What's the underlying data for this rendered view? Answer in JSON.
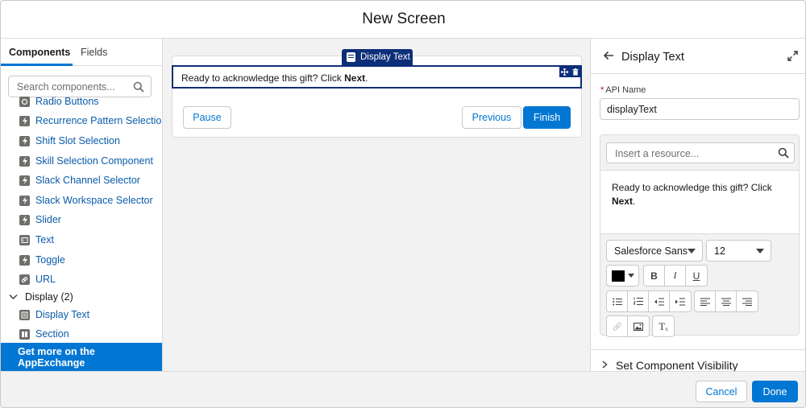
{
  "header": {
    "title": "New Screen"
  },
  "left_panel": {
    "tabs": [
      {
        "label": "Components",
        "active": true
      },
      {
        "label": "Fields",
        "active": false
      }
    ],
    "search": {
      "placeholder": "Search components..."
    },
    "items": [
      {
        "label": "Radio Buttons",
        "icon": "component-icon"
      },
      {
        "label": "Recurrence Pattern Selection",
        "icon": "lightning-icon"
      },
      {
        "label": "Shift Slot Selection",
        "icon": "lightning-icon"
      },
      {
        "label": "Skill Selection Component",
        "icon": "lightning-icon"
      },
      {
        "label": "Slack Channel Selector",
        "icon": "lightning-icon"
      },
      {
        "label": "Slack Workspace Selector",
        "icon": "lightning-icon"
      },
      {
        "label": "Slider",
        "icon": "lightning-icon"
      },
      {
        "label": "Text",
        "icon": "text-field-icon"
      },
      {
        "label": "Toggle",
        "icon": "lightning-icon"
      },
      {
        "label": "URL",
        "icon": "link-icon"
      }
    ],
    "display_section": {
      "label": "Display (2)",
      "items": [
        {
          "label": "Display Text",
          "icon": "display-text-icon"
        },
        {
          "label": "Section",
          "icon": "section-icon"
        }
      ]
    },
    "appexchange_label": "Get more on the AppExchange"
  },
  "canvas": {
    "component_tag": "Display Text",
    "display_text_prefix": "Ready to acknowledge this gift? Click ",
    "display_text_bold": "Next",
    "display_text_suffix": ".",
    "buttons": {
      "pause": "Pause",
      "previous": "Previous",
      "finish": "Finish"
    }
  },
  "properties_panel": {
    "title": "Display Text",
    "api_name_label": "API Name",
    "api_name_required": "*",
    "api_name_value": "displayText",
    "resource_placeholder": "Insert a resource...",
    "body_prefix": "Ready to acknowledge this gift? Click ",
    "body_bold": "Next",
    "body_suffix": ".",
    "font_family": "Salesforce Sans",
    "font_size": "12",
    "text_color": "#000000",
    "format_buttons": [
      "B",
      "I",
      "U"
    ],
    "clear_format_label": "T",
    "visibility_label": "Set Component Visibility"
  },
  "footer": {
    "cancel": "Cancel",
    "done": "Done"
  },
  "colors": {
    "brand": "#0176d3",
    "tag": "#0d2e78",
    "link": "#0b5cab"
  }
}
